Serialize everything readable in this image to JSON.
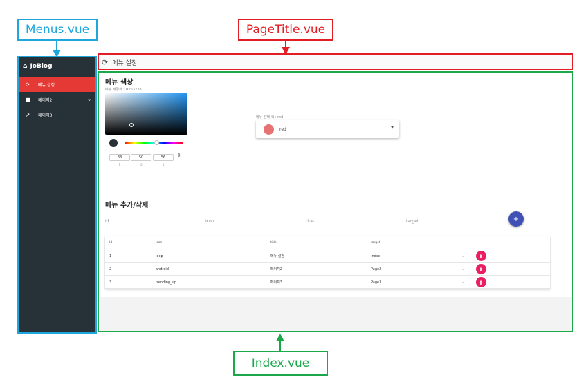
{
  "annotations": {
    "menus": {
      "label": "Menus.vue",
      "color": "#1fa7dd"
    },
    "pagetitle": {
      "label": "PageTitle.vue",
      "color": "#e31d24"
    },
    "index": {
      "label": "Index.vue",
      "color": "#1aa84a"
    }
  },
  "sidebar": {
    "brand": {
      "icon": "home-icon",
      "label": "JoBlog"
    },
    "items": [
      {
        "icon": "loop-icon",
        "label": "메뉴 설정",
        "active": true
      },
      {
        "icon": "android-icon",
        "label": "페이지2",
        "expandable": true
      },
      {
        "icon": "trending-up-icon",
        "label": "페이지3"
      }
    ],
    "accent": "#e53935",
    "background": "#263238"
  },
  "page_title": {
    "icon": "loop-icon",
    "text": "메뉴 설정"
  },
  "color_section": {
    "title": "메뉴 색상",
    "current_label": "메뉴 배경색 : #263238",
    "rgb": {
      "r": "38",
      "g": "50",
      "b": "56"
    },
    "rgb_labels": {
      "r": "R",
      "g": "G",
      "b": "B"
    },
    "select_label": "메뉴 선택 색 : red",
    "select_value": "red",
    "swatch_color": "#263238"
  },
  "menu_section": {
    "title": "메뉴 추가/삭제",
    "fields": [
      {
        "placeholder": "Id"
      },
      {
        "placeholder": "Icon"
      },
      {
        "placeholder": "title"
      },
      {
        "placeholder": "target"
      }
    ],
    "add_label": "+",
    "columns": [
      "Id",
      "Icon",
      "title",
      "target"
    ],
    "rows": [
      {
        "id": "1",
        "icon": "loop",
        "title": "메뉴 설정",
        "target": "Index"
      },
      {
        "id": "2",
        "icon": "android",
        "title": "페이지2",
        "target": "Page2"
      },
      {
        "id": "3",
        "icon": "trending_up",
        "title": "페이지3",
        "target": "Page3"
      }
    ],
    "delete_color": "#e91e63",
    "add_color": "#3f51b5"
  }
}
